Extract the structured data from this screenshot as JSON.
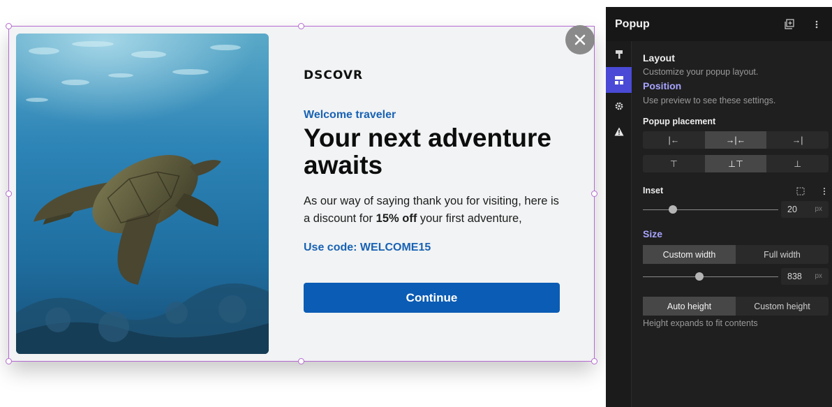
{
  "popup": {
    "logo": "DSCOVR",
    "subhead": "Welcome traveler",
    "headline": "Your next adventure awaits",
    "body_pre": "As our way of saying thank you for visiting, here is a discount for ",
    "body_bold": "15% off",
    "body_post": " your first adventure,",
    "code": "Use code: WELCOME15",
    "button": "Continue",
    "colors": {
      "accent": "#1862b4",
      "button": "#0b5cb4",
      "background": "#f1f3f4"
    }
  },
  "panel": {
    "title": "Popup",
    "header_icons": [
      "add-page-icon",
      "more-vertical-icon"
    ],
    "rail_icons": [
      "brush-icon",
      "layout-icon",
      "gear-icon",
      "warning-icon"
    ],
    "layout": {
      "title": "Layout",
      "hint": "Customize your popup layout."
    },
    "position": {
      "title": "Position",
      "hint": "Use preview to see these settings."
    },
    "placement": {
      "label": "Popup placement",
      "horizontal": [
        "|←",
        "→|←",
        "→|"
      ],
      "vertical": [
        "⊤",
        "⊥⊤",
        "⊥"
      ],
      "selected_horizontal": 1,
      "selected_vertical": 1
    },
    "inset": {
      "label": "Inset",
      "value": "20",
      "unit": "px",
      "level": 0.22
    },
    "size": {
      "title": "Size",
      "width_options": [
        "Custom width",
        "Full width"
      ],
      "width_selected": 0,
      "width_value": "838",
      "width_unit": "px",
      "width_level": 0.42,
      "height_options": [
        "Auto height",
        "Custom height"
      ],
      "height_selected": 0,
      "height_hint": "Height expands to fit contents"
    },
    "colors": {
      "accent": "#4a4ad6",
      "section_blue": "#a7a4ff"
    }
  }
}
